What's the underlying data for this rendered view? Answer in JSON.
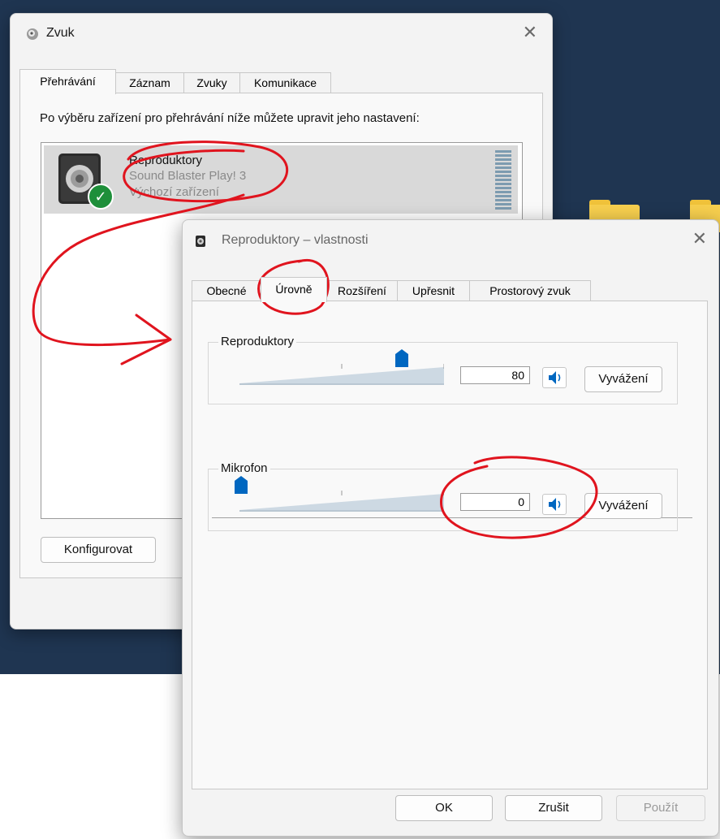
{
  "main_dialog": {
    "title": "Zvuk",
    "tabs": [
      {
        "label": "Přehrávání",
        "active": true
      },
      {
        "label": "Záznam"
      },
      {
        "label": "Zvuky"
      },
      {
        "label": "Komunikace"
      }
    ],
    "description": "Po výběru zařízení pro přehrávání níže můžete upravit jeho nastavení:",
    "device": {
      "name": "Reproduktory",
      "model": "Sound Blaster Play! 3",
      "status": "Výchozí zařízení"
    },
    "configure_label": "Konfigurovat"
  },
  "props_dialog": {
    "title": "Reproduktory – vlastnosti",
    "tabs": [
      {
        "label": "Obecné"
      },
      {
        "label": "Úrovně",
        "active": true
      },
      {
        "label": "Rozšíření"
      },
      {
        "label": "Upřesnit"
      },
      {
        "label": "Prostorový zvuk"
      }
    ],
    "speakers": {
      "label": "Reproduktory",
      "value": "80",
      "balance_label": "Vyvážení"
    },
    "microphone": {
      "label": "Mikrofon",
      "value": "0",
      "balance_label": "Vyvážení"
    },
    "ok_label": "OK",
    "cancel_label": "Zrušit",
    "apply_label": "Použít"
  },
  "colors": {
    "accent": "#0067c0",
    "annotation": "#e0141e",
    "check": "#1e8f3a"
  },
  "icons": {
    "speaker": "speaker-icon",
    "volume": "volume-icon",
    "close": "close-icon",
    "check": "check-icon"
  }
}
